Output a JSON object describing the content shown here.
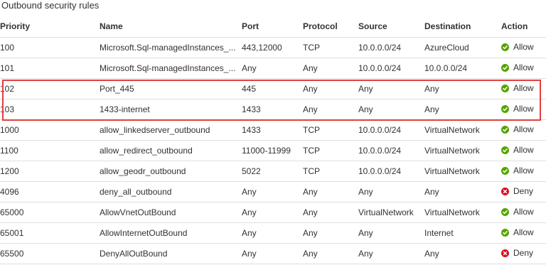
{
  "section_title": "Outbound security rules",
  "columns": {
    "priority": "Priority",
    "name": "Name",
    "port": "Port",
    "protocol": "Protocol",
    "source": "Source",
    "destination": "Destination",
    "action": "Action"
  },
  "colors": {
    "allow": "#57a300",
    "deny": "#e00b1c",
    "highlight": "#e0403f"
  },
  "rows": [
    {
      "priority": "100",
      "name": "Microsoft.Sql-managedInstances_...",
      "port": "443,12000",
      "protocol": "TCP",
      "source": "10.0.0.0/24",
      "destination": "AzureCloud",
      "action": "Allow",
      "action_icon": "check-circle-icon"
    },
    {
      "priority": "101",
      "name": "Microsoft.Sql-managedInstances_...",
      "port": "Any",
      "protocol": "Any",
      "source": "10.0.0.0/24",
      "destination": "10.0.0.0/24",
      "action": "Allow",
      "action_icon": "check-circle-icon"
    },
    {
      "priority": "102",
      "name": "Port_445",
      "port": "445",
      "protocol": "Any",
      "source": "Any",
      "destination": "Any",
      "action": "Allow",
      "action_icon": "check-circle-icon"
    },
    {
      "priority": "103",
      "name": "1433-internet",
      "port": "1433",
      "protocol": "Any",
      "source": "Any",
      "destination": "Any",
      "action": "Allow",
      "action_icon": "check-circle-icon"
    },
    {
      "priority": "1000",
      "name": "allow_linkedserver_outbound",
      "port": "1433",
      "protocol": "TCP",
      "source": "10.0.0.0/24",
      "destination": "VirtualNetwork",
      "action": "Allow",
      "action_icon": "check-circle-icon"
    },
    {
      "priority": "1100",
      "name": "allow_redirect_outbound",
      "port": "11000-11999",
      "protocol": "TCP",
      "source": "10.0.0.0/24",
      "destination": "VirtualNetwork",
      "action": "Allow",
      "action_icon": "check-circle-icon"
    },
    {
      "priority": "1200",
      "name": "allow_geodr_outbound",
      "port": "5022",
      "protocol": "TCP",
      "source": "10.0.0.0/24",
      "destination": "VirtualNetwork",
      "action": "Allow",
      "action_icon": "check-circle-icon"
    },
    {
      "priority": "4096",
      "name": "deny_all_outbound",
      "port": "Any",
      "protocol": "Any",
      "source": "Any",
      "destination": "Any",
      "action": "Deny",
      "action_icon": "x-circle-icon"
    },
    {
      "priority": "65000",
      "name": "AllowVnetOutBound",
      "port": "Any",
      "protocol": "Any",
      "source": "VirtualNetwork",
      "destination": "VirtualNetwork",
      "action": "Allow",
      "action_icon": "check-circle-icon"
    },
    {
      "priority": "65001",
      "name": "AllowInternetOutBound",
      "port": "Any",
      "protocol": "Any",
      "source": "Any",
      "destination": "Internet",
      "action": "Allow",
      "action_icon": "check-circle-icon"
    },
    {
      "priority": "65500",
      "name": "DenyAllOutBound",
      "port": "Any",
      "protocol": "Any",
      "source": "Any",
      "destination": "Any",
      "action": "Deny",
      "action_icon": "x-circle-icon"
    }
  ]
}
